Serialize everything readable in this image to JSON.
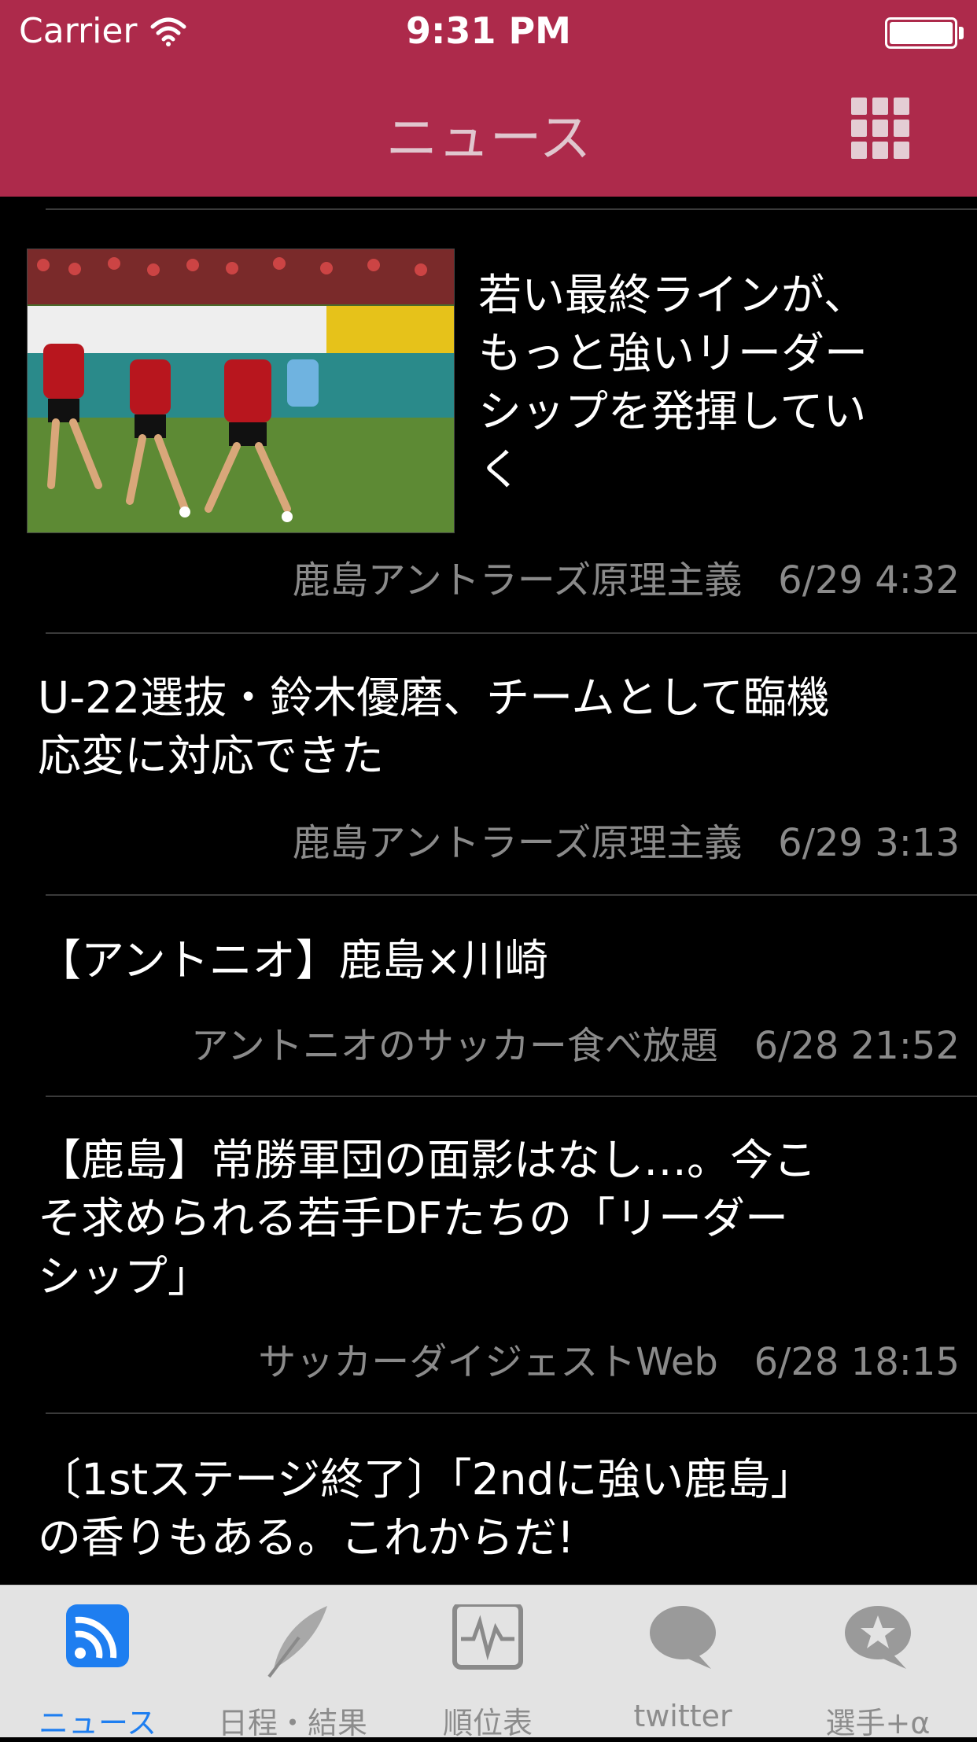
{
  "status_bar": {
    "carrier": "Carrier",
    "time": "9:31 PM"
  },
  "header": {
    "title": "ニュース",
    "menu_icon": "grid-icon"
  },
  "articles": [
    {
      "title": "若い最終ラインが、もっと強いリーダーシップを発揮していく",
      "title_lines": [
        "若い最終ラインが、",
        "もっと強いリーダー",
        "シップを発揮してい",
        "く"
      ],
      "source": "鹿島アントラーズ原理主義",
      "date": "6/29 4:32",
      "has_image": true
    },
    {
      "title": "U-22選抜・鈴木優磨、チームとして臨機応変に対応できた",
      "title_lines": [
        "U-22選抜・鈴木優磨、チームとして臨機",
        "応変に対応できた"
      ],
      "source": "鹿島アントラーズ原理主義",
      "date": "6/29 3:13"
    },
    {
      "title": "【アントニオ】鹿島×川崎",
      "title_lines": [
        "【アントニオ】鹿島×川崎"
      ],
      "source": "アントニオのサッカー食べ放題",
      "date": "6/28 21:52"
    },
    {
      "title": "【鹿島】常勝軍団の面影はなし…。今こそ求められる若手DFたちの「リーダーシップ」",
      "title_lines": [
        "【鹿島】常勝軍団の面影はなし…。今こ",
        "そ求められる若手DFたちの「リーダー",
        "シップ」"
      ],
      "source": "サッカーダイジェストWeb",
      "date": "6/28 18:15"
    },
    {
      "title": "〔1stステージ終了〕「2ndに強い鹿島」の香りもある。これからだ!",
      "title_lines": [
        "〔1stステージ終了〕「2ndに強い鹿島」",
        "の香りもある。これからだ!"
      ]
    }
  ],
  "tabbar": {
    "tabs": [
      {
        "label": "ニュース",
        "icon": "rss-icon",
        "active": true
      },
      {
        "label": "日程・結果",
        "icon": "feather-icon",
        "active": false
      },
      {
        "label": "順位表",
        "icon": "chart-icon",
        "active": false
      },
      {
        "label": "twitter",
        "icon": "speech-bubble-icon",
        "active": false
      },
      {
        "label": "選手+α",
        "icon": "star-bubble-icon",
        "active": false
      }
    ]
  },
  "colors": {
    "header": "#ad2a4b",
    "active_tab": "#1e7ef0",
    "tabbar": "#e3e3e3",
    "meta_text": "#8a8a8a"
  }
}
